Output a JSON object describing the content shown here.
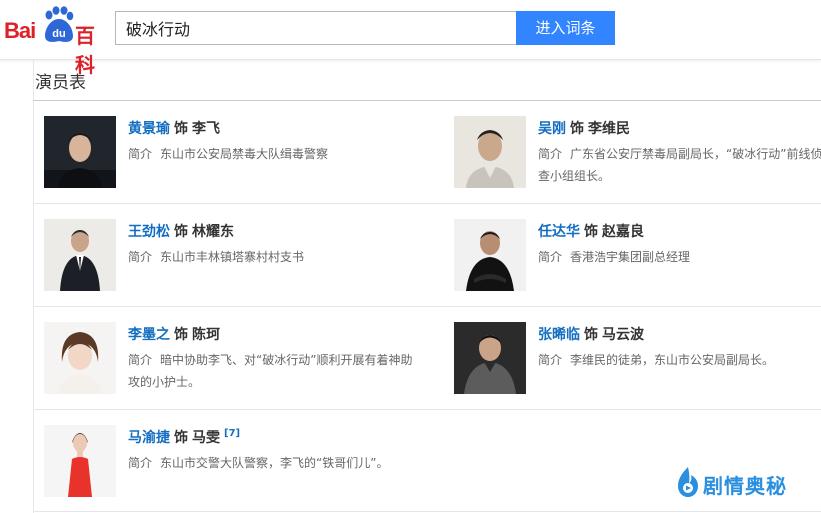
{
  "header": {
    "logo_left": "Bai",
    "logo_du": "du",
    "logo_right": "百科",
    "search_value": "破冰行动",
    "search_button": "进入词条"
  },
  "section": {
    "title": "演员表"
  },
  "desc_label": "简介",
  "shi": "饰",
  "actors": [
    {
      "name": "黄景瑜",
      "role": "李飞",
      "desc": "东山市公安局禁毒大队缉毒警察"
    },
    {
      "name": "吴刚",
      "role": "李维民",
      "desc": "广东省公安厅禁毒局副局长，“破冰行动”前线侦查小组组长。"
    },
    {
      "name": "王劲松",
      "role": "林耀东",
      "desc": "东山市丰林镇塔寨村村支书"
    },
    {
      "name": "任达华",
      "role": "赵嘉良",
      "desc": "香港浩宇集团副总经理"
    },
    {
      "name": "李墨之",
      "role": "陈珂",
      "desc": "暗中协助李飞、对“破冰行动”顺利开展有着神助攻的小护士。"
    },
    {
      "name": "张晞临",
      "role": "马云波",
      "desc": "李维民的徒弟，东山市公安局副局长。"
    },
    {
      "name": "马渝捷",
      "role": "马雯",
      "ref": "[7]",
      "desc": "东山市交警大队警察，李飞的“铁哥们儿”。"
    }
  ],
  "watermark": {
    "text": "剧情奥秘"
  },
  "colors": {
    "accent": "#3385ff",
    "link": "#136ec2",
    "brand": "#de2129"
  }
}
